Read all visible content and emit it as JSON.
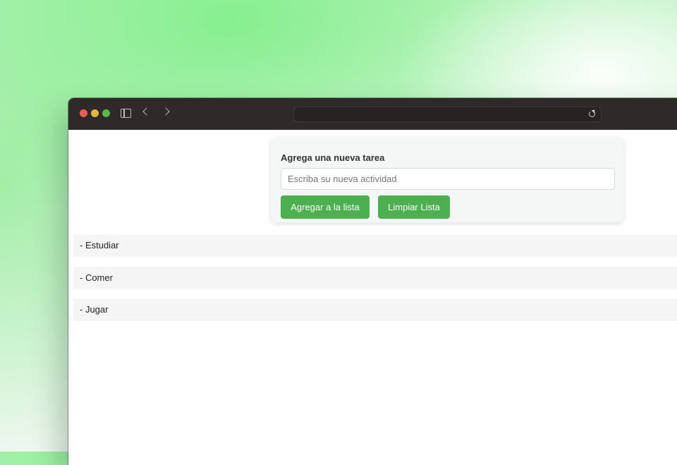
{
  "browser": {
    "address_bar_value": ""
  },
  "form": {
    "label": "Agrega una nueva tarea",
    "input_placeholder": "Escriba su nueva actividad",
    "input_value": "",
    "add_button_label": "Agregar a la lista",
    "clear_button_label": "Limpiar Lista"
  },
  "tasks": [
    {
      "label": "- Estudiar"
    },
    {
      "label": "- Comer"
    },
    {
      "label": "- Jugar"
    }
  ],
  "colors": {
    "accent_button": "#4caf50",
    "titlebar": "#2d2a29",
    "background_glow": "#86ef8e"
  },
  "icons": [
    "close-dot-icon",
    "minimize-dot-icon",
    "zoom-dot-icon",
    "sidebar-icon",
    "back-arrow-icon",
    "forward-arrow-icon",
    "reload-icon"
  ]
}
